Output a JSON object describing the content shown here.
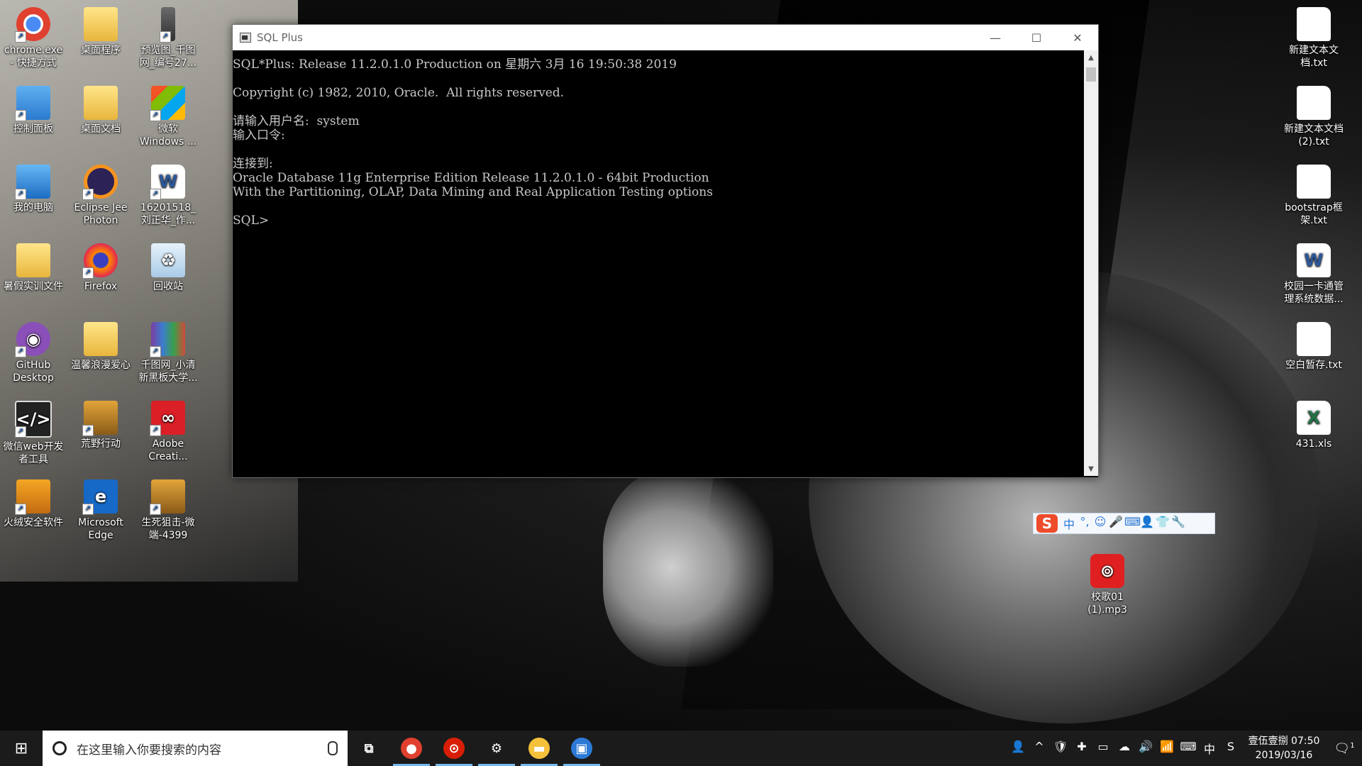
{
  "desktop": {
    "left_icons": [
      {
        "label": "chrome.exe\n- 快捷方式",
        "icon": "chrome-icon"
      },
      {
        "label": "桌面程序",
        "icon": "folder-icon"
      },
      {
        "label": "预览图_千图\n网_编号27...",
        "icon": "image-file-icon"
      },
      {
        "label": "控制面板",
        "icon": "control-panel-icon"
      },
      {
        "label": "桌面文档",
        "icon": "folder-icon"
      },
      {
        "label": "微软\nWindows ...",
        "icon": "windows-icon"
      },
      {
        "label": "我的电脑",
        "icon": "computer-icon"
      },
      {
        "label": "Eclipse Jee\nPhoton",
        "icon": "eclipse-icon"
      },
      {
        "label": "16201518_\n刘正华_作...",
        "icon": "word-doc-icon"
      },
      {
        "label": "暑假实训文件",
        "icon": "folder-icon"
      },
      {
        "label": "Firefox",
        "icon": "firefox-icon"
      },
      {
        "label": "回收站",
        "icon": "recycle-bin-icon"
      },
      {
        "label": "GitHub\nDesktop",
        "icon": "github-icon"
      },
      {
        "label": "温馨浪漫爱心",
        "icon": "folder-icon"
      },
      {
        "label": "千图网_小清\n新黑板大学...",
        "icon": "rar-archive-icon"
      },
      {
        "label": "微信web开发\n者工具",
        "icon": "wechat-devtools-icon"
      },
      {
        "label": "荒野行动",
        "icon": "game-icon"
      },
      {
        "label": "Adobe\nCreati...",
        "icon": "adobe-cc-icon"
      },
      {
        "label": "火绒安全软件",
        "icon": "huorong-icon"
      },
      {
        "label": "Microsoft\nEdge",
        "icon": "edge-icon"
      },
      {
        "label": "生死狙击-微\n端-4399",
        "icon": "game-icon"
      }
    ],
    "right_icons": [
      {
        "label": "新建文本文\n档.txt",
        "icon": "text-file-icon"
      },
      {
        "label": "新建文本文档\n(2).txt",
        "icon": "text-file-icon"
      },
      {
        "label": "bootstrap框\n架.txt",
        "icon": "text-file-icon"
      },
      {
        "label": "校园一卡通管\n理系统数据...",
        "icon": "word-doc-icon"
      },
      {
        "label": "空白暂存.txt",
        "icon": "text-file-icon"
      },
      {
        "label": "431.xls",
        "icon": "excel-file-icon"
      },
      {
        "label": "校歌01\n(1).mp3",
        "icon": "netease-music-icon"
      }
    ]
  },
  "window": {
    "title": "SQL Plus",
    "minimize": "—",
    "maximize": "☐",
    "close": "✕",
    "console_lines": [
      "SQL*Plus: Release 11.2.0.1.0 Production on 星期六 3月 16 19:50:38 2019",
      "",
      "Copyright (c) 1982, 2010, Oracle.  All rights reserved.",
      "",
      "请输入用户名:  system",
      "输入口令:",
      "",
      "连接到:",
      "Oracle Database 11g Enterprise Edition Release 11.2.0.1.0 - 64bit Production",
      "With the Partitioning, OLAP, Data Mining and Real Application Testing options",
      "",
      "SQL>"
    ]
  },
  "ime": {
    "logo": "S",
    "items": [
      "中",
      "°,",
      "☺",
      "🎤",
      "⌨",
      "👤",
      "👕",
      "🔧"
    ]
  },
  "taskbar": {
    "start_icon": "windows-start-icon",
    "search_placeholder": "在这里输入你要搜索的内容",
    "apps": [
      {
        "name": "task-view-icon",
        "glyph": "⧉",
        "active": false,
        "color": "transparent"
      },
      {
        "name": "chrome-icon",
        "glyph": "●",
        "active": true,
        "color": "#e0402f"
      },
      {
        "name": "netease-music-icon",
        "glyph": "⊙",
        "active": true,
        "color": "#d81e06"
      },
      {
        "name": "settings-gear-icon",
        "glyph": "⚙",
        "active": true,
        "color": "transparent"
      },
      {
        "name": "file-explorer-icon",
        "glyph": "▬",
        "active": true,
        "color": "#f3c13a"
      },
      {
        "name": "sqlplus-icon",
        "glyph": "▣",
        "active": true,
        "color": "#2d7ad6"
      }
    ],
    "tray": [
      "👤",
      "^",
      "🛡",
      "✚",
      "▭",
      "☁",
      "🔊",
      "📶",
      "⌨",
      "中",
      "S"
    ],
    "clock_line1": "壹伍壹捌 07:50",
    "clock_line2": "2019/03/16",
    "notification_count": "1"
  }
}
